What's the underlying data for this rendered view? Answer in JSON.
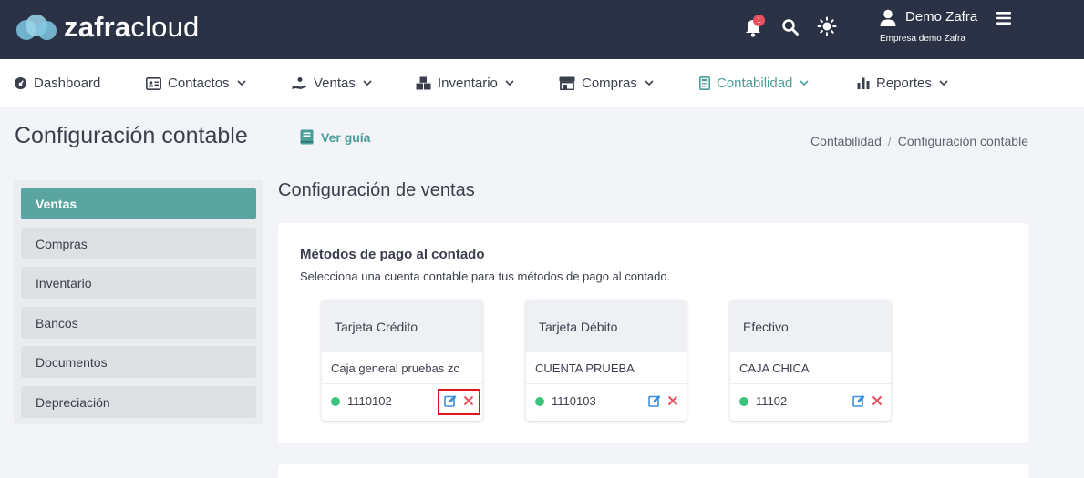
{
  "brand": {
    "light": "zafra",
    "bold_part": "zafra",
    "rest": "cloud"
  },
  "header": {
    "notification_count": "1",
    "user_name": "Demo Zafra",
    "company": "Empresa demo Zafra"
  },
  "nav": [
    {
      "label": "Dashboard",
      "icon": "dashboard-icon"
    },
    {
      "label": "Contactos",
      "icon": "contacts-icon"
    },
    {
      "label": "Ventas",
      "icon": "sales-icon"
    },
    {
      "label": "Inventario",
      "icon": "inventory-icon"
    },
    {
      "label": "Compras",
      "icon": "store-icon"
    },
    {
      "label": "Contabilidad",
      "icon": "calculator-icon"
    },
    {
      "label": "Reportes",
      "icon": "bar-chart-icon"
    }
  ],
  "page": {
    "title": "Configuración contable",
    "guide_label": "Ver guía",
    "breadcrumb": [
      "Contabilidad",
      "/",
      "Configuración contable"
    ]
  },
  "sidebar": [
    "Ventas",
    "Compras",
    "Inventario",
    "Bancos",
    "Documentos",
    "Depreciación"
  ],
  "main": {
    "section_title": "Configuración de ventas",
    "panel_title": "Métodos de pago al contado",
    "panel_subtitle": "Selecciona una cuenta contable para tus métodos de pago al contado.",
    "cards": [
      {
        "method": "Tarjeta Crédito",
        "account": "Caja general pruebas zc",
        "code": "1110102"
      },
      {
        "method": "Tarjeta Débito",
        "account": "CUENTA PRUEBA",
        "code": "1110103"
      },
      {
        "method": "Efectivo",
        "account": "CAJA CHICA",
        "code": "11102"
      }
    ]
  },
  "colors": {
    "topbar": "#2b3245",
    "accent": "#4a9e98",
    "active_sidebar": "#5aa5a0",
    "status_dot": "#3cc47c",
    "edit_icon": "#3d8fd9",
    "delete_icon": "#e8505b",
    "highlight": "#e3121a"
  }
}
